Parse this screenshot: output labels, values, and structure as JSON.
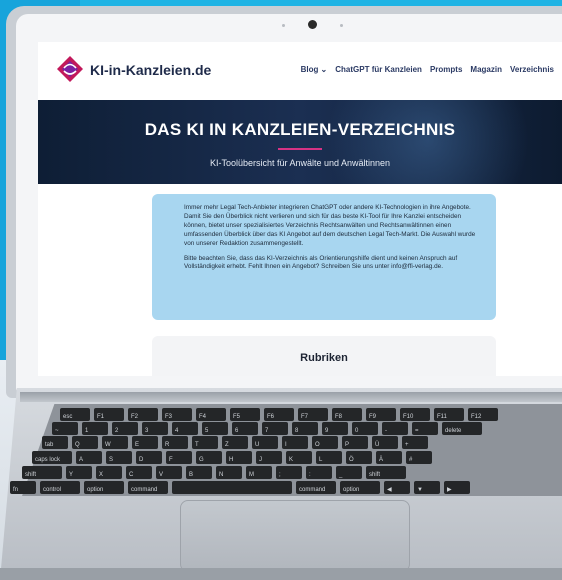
{
  "site": {
    "logo_text": "KI-in-Kanzleien.de",
    "brand_color": "#d63384"
  },
  "nav": {
    "items": [
      "Blog ⌄",
      "ChatGPT für Kanzleien",
      "Prompts",
      "Magazin",
      "Verzeichnis"
    ]
  },
  "hero": {
    "title": "DAS KI IN KANZLEIEN-VERZEICHNIS",
    "subtitle": "KI-Toolübersicht für Anwälte und Anwältinnen"
  },
  "infobox": {
    "paragraph1": "Immer mehr Legal Tech-Anbieter integrieren ChatGPT oder andere KI-Technologien in ihre Angebote. Damit Sie den Überblick nicht verlieren und sich für das beste KI-Tool für Ihre Kanzlei entscheiden können, bietet unser spezialisiertes Verzeichnis Rechtsanwälten und Rechtsanwältinnen einen umfassenden Überblick über das KI Angebot auf dem deutschen Legal Tech-Markt. Die Auswahl wurde von unserer Redaktion zusammengestellt.",
    "paragraph2": "Bitte beachten Sie, dass das KI-Verzeichnis als Orientierungshilfe dient und keinen Anspruch auf Vollständigkeit erhebt. Fehlt Ihnen ein Angebot? Schreiben Sie uns unter info@ffi-verlag.de."
  },
  "rubriken": {
    "title": "Rubriken"
  },
  "keyboard": {
    "rows": [
      [
        "esc",
        "F1",
        "F2",
        "F3",
        "F4",
        "F5",
        "F6",
        "F7",
        "F8",
        "F9",
        "F10",
        "F11",
        "F12"
      ],
      [
        "~",
        "1",
        "2",
        "3",
        "4",
        "5",
        "6",
        "7",
        "8",
        "9",
        "0",
        "-",
        "=",
        "delete"
      ],
      [
        "tab",
        "Q",
        "W",
        "E",
        "R",
        "T",
        "Z",
        "U",
        "I",
        "O",
        "P",
        "Ü",
        "+"
      ],
      [
        "caps lock",
        "A",
        "S",
        "D",
        "F",
        "G",
        "H",
        "J",
        "K",
        "L",
        "Ö",
        "Ä",
        "#"
      ],
      [
        "shift",
        "Y",
        "X",
        "C",
        "V",
        "B",
        "N",
        "M",
        ";",
        ":",
        "_",
        "shift"
      ],
      [
        "fn",
        "control",
        "option",
        "command",
        "",
        "command",
        "option",
        "◀",
        "▼",
        "▶"
      ]
    ]
  }
}
